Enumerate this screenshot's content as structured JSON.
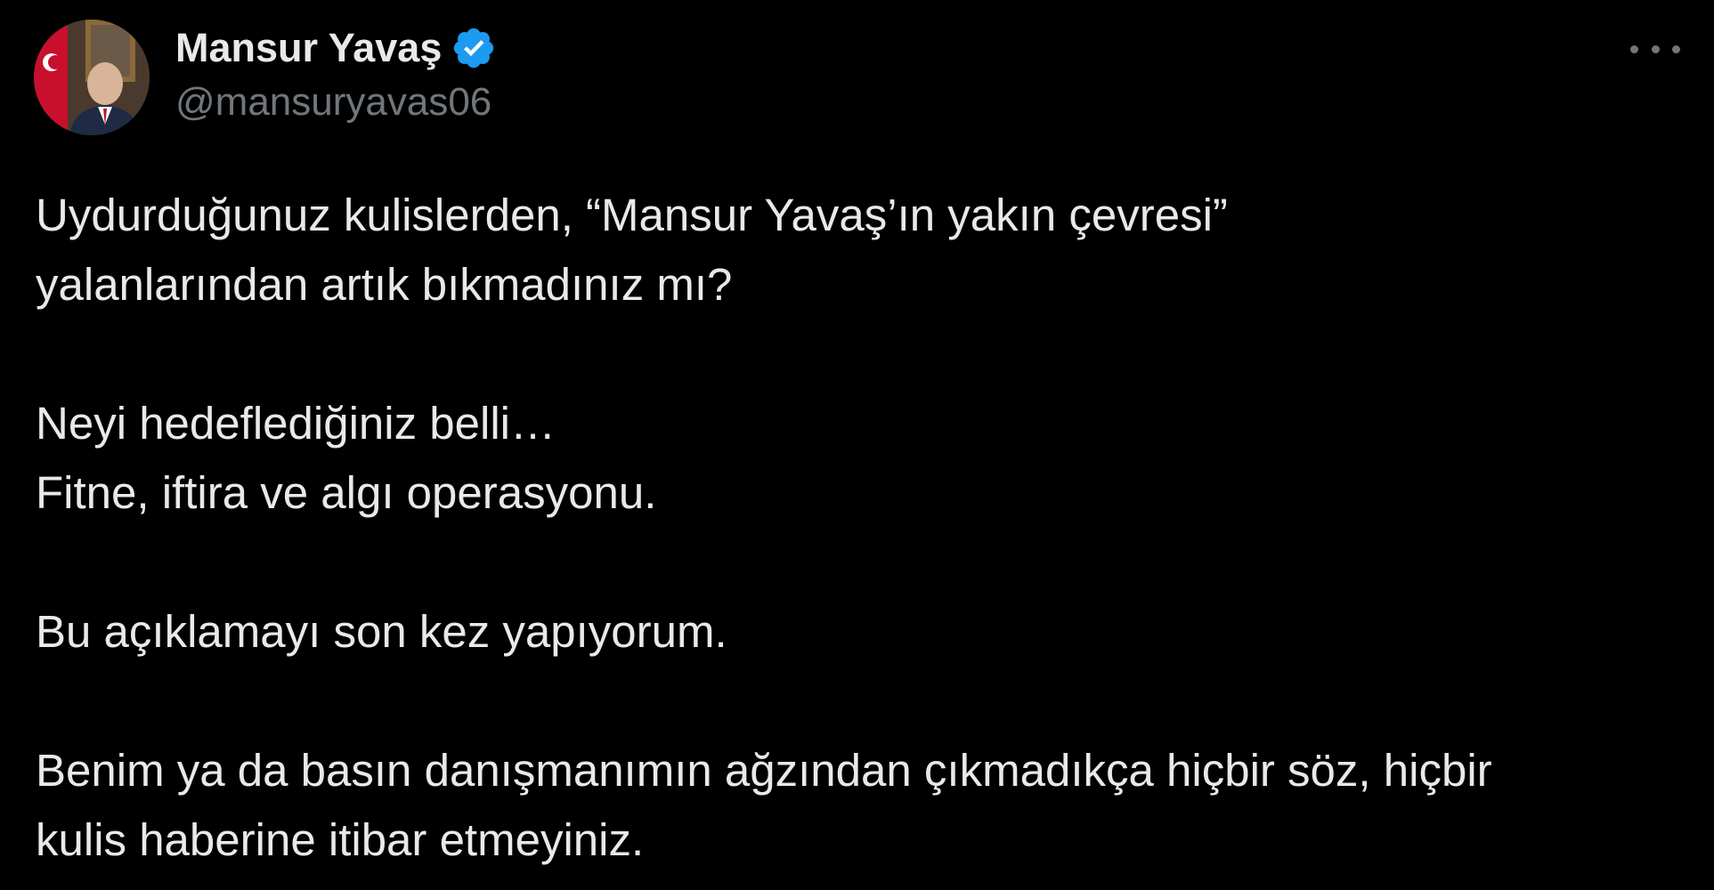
{
  "tweet": {
    "author": {
      "display_name": "Mansur Yavaş",
      "handle": "@mansuryavas06",
      "verified": true,
      "verified_color": "#1d9bf0"
    },
    "more_icon": "more-horizontal-icon",
    "paragraphs": [
      [
        "Uydurduğunuz kulislerden, “Mansur Yavaş’ın yakın çevresi”",
        "yalanlarından artık bıkmadınız mı?"
      ],
      [
        "Neyi hedeflediğiniz belli…",
        "Fitne, iftira ve algı operasyonu."
      ],
      [
        "Bu açıklamayı son kez yapıyorum."
      ],
      [
        "Benim ya da basın danışmanımın ağzından çıkmadıkça hiçbir söz, hiçbir",
        "kulis haberine itibar etmeyiniz."
      ]
    ]
  },
  "colors": {
    "background": "#000000",
    "text_primary": "#e7e9ea",
    "text_secondary": "#71767b"
  }
}
